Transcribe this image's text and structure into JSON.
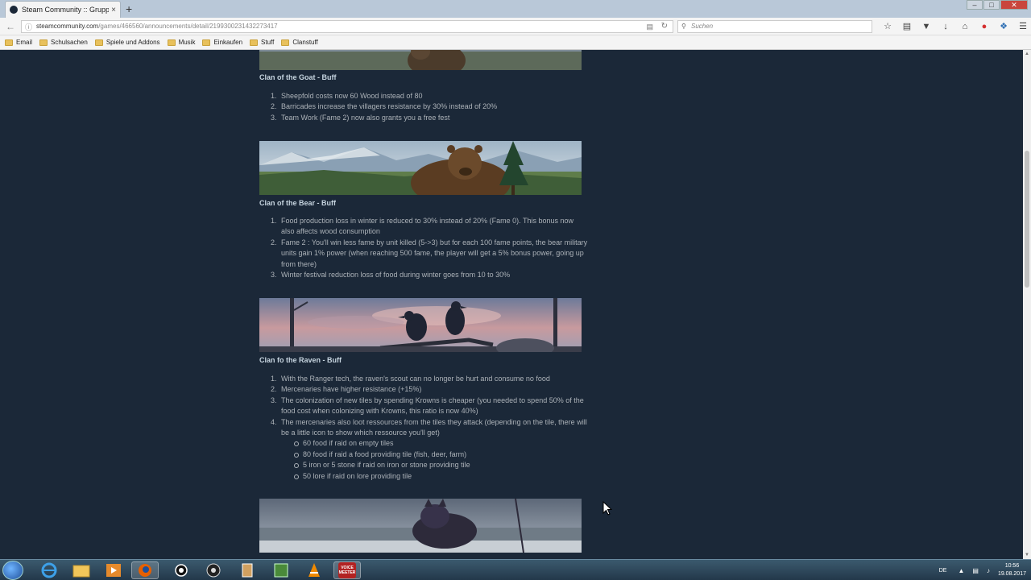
{
  "browser": {
    "tab_title": "Steam Community :: Gruppe",
    "tab_close": "×",
    "new_tab": "+",
    "url_domain": "steamcommunity.com",
    "url_path": "/games/466560/announcements/detail/2199300231432273417",
    "search_placeholder": "Suchen",
    "bookmarks": [
      "Email",
      "Schulsachen",
      "Spiele und Addons",
      "Musik",
      "Einkaufen",
      "Stuff",
      "Clanstuff"
    ]
  },
  "article": {
    "sections": [
      {
        "heading": "Clan of the Goat - Buff",
        "items": [
          "Sheepfold costs now 60 Wood instead of 80",
          "Barricades increase the villagers resistance by 30% instead of 20%",
          "Team Work (Fame 2) now also grants you a free fest"
        ]
      },
      {
        "heading": "Clan of the Bear - Buff",
        "items": [
          "Food production loss in winter is reduced to 30% instead of 20% (Fame 0). This bonus now also affects wood consumption",
          "Fame 2 : You'll win less fame by unit killed (5->3) but for each 100 fame points, the bear military units gain 1% power (when reaching 500 fame, the player will get a 5% bonus power, going up from there)",
          "Winter festival reduction loss of food during winter goes from 10 to 30%"
        ]
      },
      {
        "heading": "Clan fo the Raven - Buff",
        "items": [
          "With the Ranger tech, the raven's scout can no longer be hurt and consume no food",
          "Mercenaries have higher resistance (+15%)",
          "The colonization of new tiles by spending Krowns is cheaper (you needed to spend 50% of the food cost when colonizing with Krowns, this ratio is now 40%)",
          "The mercenaries also loot ressources from the tiles they attack (depending on the tile, there will be a little icon to show which ressource you'll get)"
        ],
        "subitems": [
          "60 food if raid on empty tiles",
          "80 food if raid a food providing tile (fish, deer, farm)",
          "5 iron or 5 stone if raid on iron or stone providing tile",
          "50 lore if raid on lore providing tile"
        ]
      }
    ]
  },
  "taskbar": {
    "voicemeeter_line1": "VOICE",
    "voicemeeter_line2": "MEETER",
    "language": "DE",
    "time": "10:56",
    "date": "19.08.2017"
  },
  "colors": {
    "page_bg": "#1b2838",
    "heading": "#c6d4df",
    "text": "#acb2b8"
  }
}
